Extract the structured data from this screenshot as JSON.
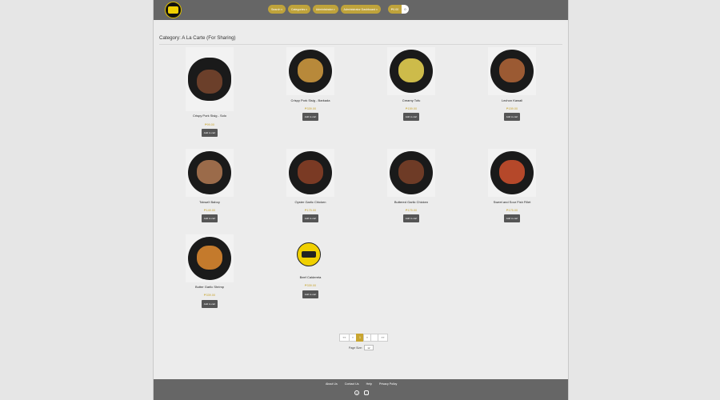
{
  "header": {
    "nav": [
      "Search",
      "Categories",
      "Administrator",
      "Administrator Dashboard"
    ],
    "cart_label": "₱0.00",
    "cart_count": "0"
  },
  "page": {
    "category_title": "Category: A La Carte (For Sharing)"
  },
  "products": [
    {
      "name": "Crispy Pork Sisig - Solo",
      "price": "₱99.00",
      "add": "Add to cart",
      "food_color": "#6b3f2a"
    },
    {
      "name": "Crispy Pork Sisig - Barkada",
      "price": "₱339.00",
      "add": "Add to cart",
      "food_color": "#b8893a"
    },
    {
      "name": "Creamy Tofu",
      "price": "₱159.00",
      "add": "Add to cart",
      "food_color": "#cdbb4a"
    },
    {
      "name": "Lechon Kawali",
      "price": "₱159.00",
      "add": "Add to cart",
      "food_color": "#9b5a33"
    },
    {
      "name": "Tokwa't Baboy",
      "price": "₱149.00",
      "add": "Add to cart",
      "food_color": "#9b6b4a"
    },
    {
      "name": "Oyster Garlic Chicken",
      "price": "₱175.00",
      "add": "Add to cart",
      "food_color": "#7a3a24"
    },
    {
      "name": "Buttered Garlic Chicken",
      "price": "₱175.00",
      "add": "Add to cart",
      "food_color": "#6e3b26"
    },
    {
      "name": "Sweet and Sour Fish Fillet",
      "price": "₱175.00",
      "add": "Add to cart",
      "food_color": "#b5482a"
    },
    {
      "name": "Butter Garlic Shrimp",
      "price": "₱339.00",
      "add": "Add to cart",
      "food_color": "#c47a2c"
    },
    {
      "name": "Beef Caldereta",
      "price": "₱339.00",
      "add": "Add to cart",
      "food_color": ""
    }
  ],
  "pagination": {
    "first": "««",
    "prev": "«",
    "current": "1",
    "next": "»",
    "last": "»»",
    "page_size_label": "Page Size:",
    "page_size_value": "12"
  },
  "footer": {
    "links": [
      "About Us",
      "Contact Us",
      "Help",
      "Privacy Policy"
    ],
    "icons": [
      "facebook-icon",
      "instagram-icon"
    ]
  },
  "colors": {
    "accent": "#c8a530",
    "topbar": "#666666",
    "button": "#555555"
  }
}
